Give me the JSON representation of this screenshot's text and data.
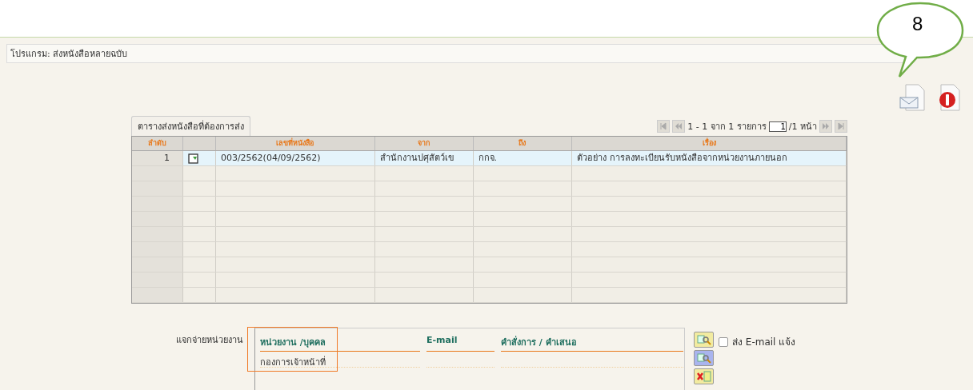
{
  "program_bar": {
    "text": "โปรแกรม: ส่งหนังสือหลายฉบับ"
  },
  "callout": {
    "text": "8"
  },
  "table": {
    "tab": "ตารางส่งหนังสือที่ต้องการส่ง",
    "pager": {
      "range": "1 - 1 จาก 1 รายการ",
      "page": "1",
      "total": "/1 หน้า"
    },
    "columns": [
      "ลำดับ",
      "",
      "เลขที่หนังสือ",
      "จาก",
      "ถึง",
      "เรื่อง"
    ],
    "rows": [
      {
        "selected": true,
        "cells": [
          "1",
          "",
          "003/2562(04/09/2562)",
          "สำนักงานปศุสัตว์เข",
          "กกจ.",
          "ตัวอย่าง การลงทะเบียนรับหนังสือจากหน่วยงานภายนอก"
        ]
      }
    ]
  },
  "distribution": {
    "label": "แจกจ่ายหน่วยงาน",
    "columns": [
      "หน่วยงาน /บุคคล",
      "E-mail",
      "คำสั่งการ / คำเสนอ"
    ],
    "rows": [
      [
        "กองการเจ้าหน้าที่",
        "",
        ""
      ]
    ],
    "email_option": {
      "label": "ส่ง E-mail แจ้ง",
      "checked": false
    }
  }
}
